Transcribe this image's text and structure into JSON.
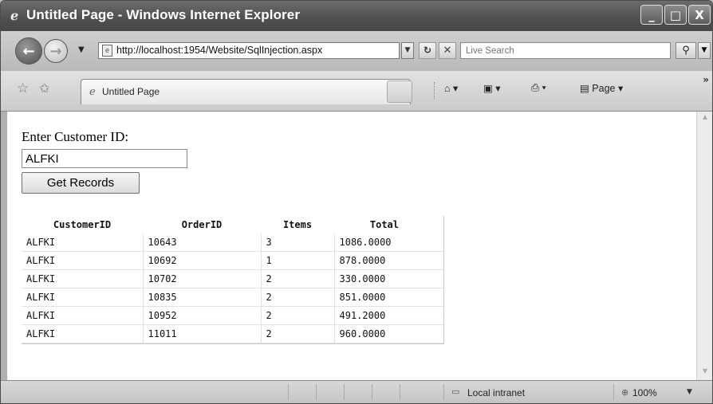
{
  "window": {
    "title": "Untitled Page - Windows Internet Explorer",
    "controls": {
      "minimize": "_",
      "maximize": "□",
      "close": "X"
    }
  },
  "addressbar": {
    "url": "http://localhost:1954/Website/SqlInjection.aspx",
    "search_placeholder": "Live Search"
  },
  "tabs": [
    {
      "label": "Untitled Page"
    }
  ],
  "commandbar": {
    "page_label": "Page"
  },
  "page": {
    "customer_label": "Enter Customer ID:",
    "customer_value": "ALFKI",
    "get_records_label": "Get Records",
    "grid": {
      "columns": [
        "CustomerID",
        "OrderID",
        "Items",
        "Total"
      ],
      "rows": [
        [
          "ALFKI",
          "10643",
          "3",
          "1086.0000"
        ],
        [
          "ALFKI",
          "10692",
          "1",
          "878.0000"
        ],
        [
          "ALFKI",
          "10702",
          "2",
          "330.0000"
        ],
        [
          "ALFKI",
          "10835",
          "2",
          "851.0000"
        ],
        [
          "ALFKI",
          "10952",
          "2",
          "491.2000"
        ],
        [
          "ALFKI",
          "11011",
          "2",
          "960.0000"
        ]
      ]
    }
  },
  "statusbar": {
    "zone": "Local intranet",
    "zoom": "100%"
  },
  "icons": {
    "back": "back-arrow-icon",
    "forward": "forward-arrow-icon",
    "refresh": "refresh-icon",
    "stop": "stop-icon",
    "search": "magnifier-icon",
    "favorites": "favorites-star-icon",
    "home": "home-icon",
    "feeds": "rss-feed-icon",
    "print": "printer-icon",
    "zone": "intranet-zone-icon"
  }
}
